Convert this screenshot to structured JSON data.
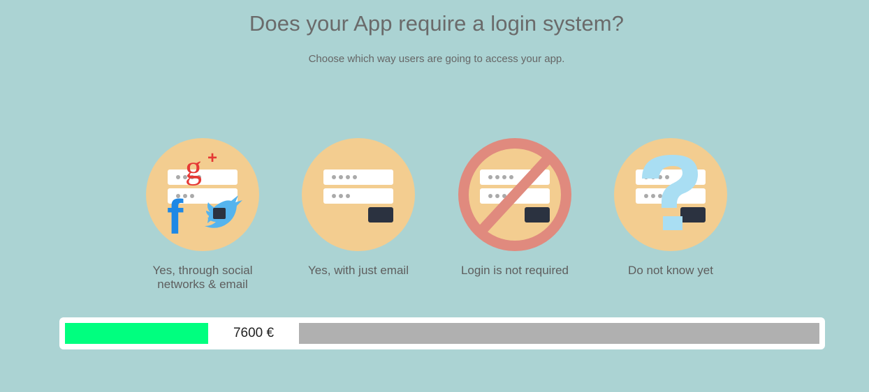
{
  "header": {
    "title": "Does your App require a login system?",
    "subtitle": "Choose which way users are going to access your app."
  },
  "options": [
    {
      "label": "Yes, through social networks & email",
      "icon": "social-login-icon"
    },
    {
      "label": "Yes, with just email",
      "icon": "email-login-icon"
    },
    {
      "label": "Login is not required",
      "icon": "no-login-icon"
    },
    {
      "label": "Do not know yet",
      "icon": "question-login-icon"
    }
  ],
  "progress": {
    "price": "7600 €",
    "fill_fraction": 0.19
  },
  "colors": {
    "background": "#abd3d3",
    "circle": "#f3cd90",
    "progress_fill": "#00ff7f",
    "progress_remaining": "#b0b0b0",
    "prohibited": "#e08a7e",
    "question": "#a9def3",
    "google": "#e53935",
    "facebook": "#1e88e5",
    "twitter": "#55b4ee"
  }
}
